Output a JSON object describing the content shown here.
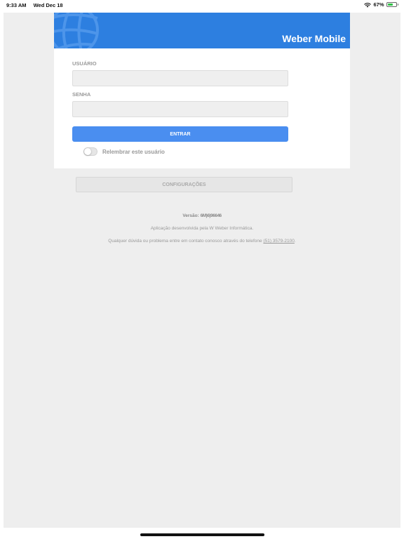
{
  "status_bar": {
    "time": "9:33 AM",
    "date": "Wed Dec 18",
    "battery": "67%",
    "battery_level": 0.67,
    "battery_color": "#2fbf46"
  },
  "header": {
    "title": "Weber Mobile",
    "logo_icon": "globe-logo-icon",
    "background": "#2d7fe0"
  },
  "login": {
    "user_label": "USUÁRIO",
    "user_value": "",
    "password_label": "SENHA",
    "password_value": "",
    "enter_label": "ENTRAR",
    "enter_color": "#4a8ef0",
    "remember_label": "Relembrar este usuário",
    "remember_enabled": false
  },
  "settings": {
    "label": "CONFIGURAÇÕES"
  },
  "footer": {
    "version_label": "Versão:",
    "version_value": "6M)6)96646",
    "developer_text": "Aplicação desenvolvida pela W Weber Informática.",
    "contact_text": "Qualquer dúvida ou problema entre em contato conosco através do telefone",
    "phone": "(51) 3579-2100",
    "contact_suffix": "."
  }
}
